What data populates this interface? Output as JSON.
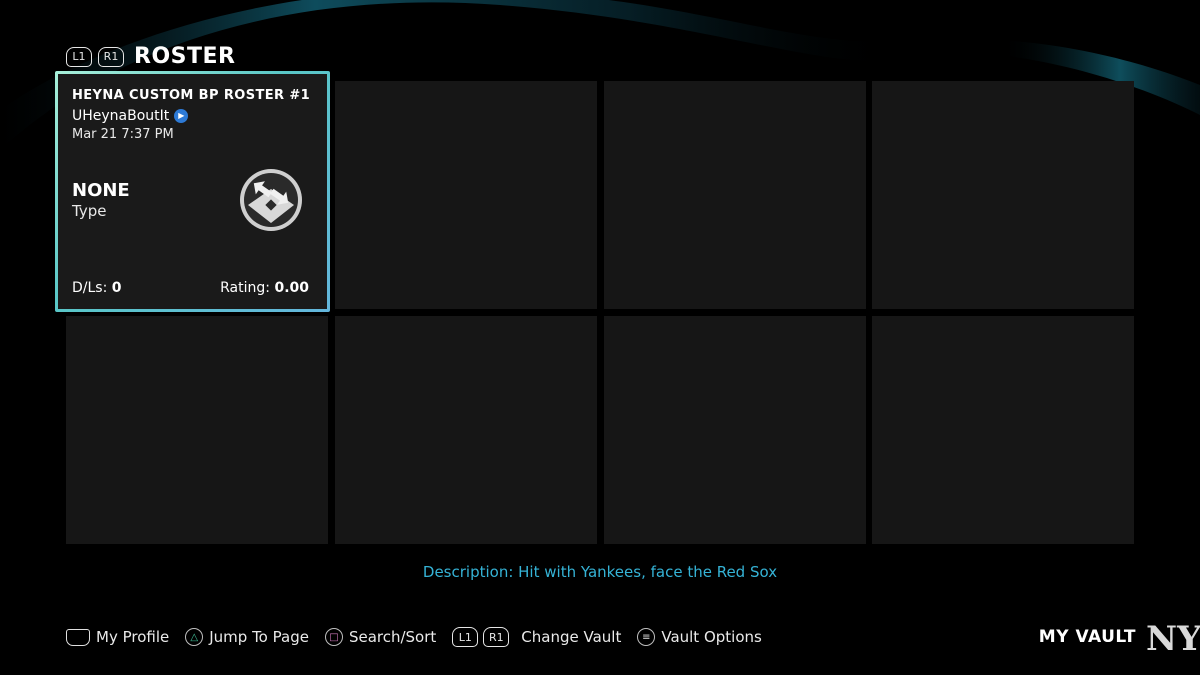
{
  "header": {
    "left_bumper": "L1",
    "right_bumper": "R1",
    "title": "ROSTER"
  },
  "selected_card": {
    "title": "HEYNA CUSTOM BP ROSTER #1",
    "username": "UHeynaBoutIt",
    "platform_badge": "ps",
    "date": "Mar 21 7:37 PM",
    "type_value": "NONE",
    "type_label": "Type",
    "icon": "roster-exchange-icon",
    "downloads_label": "D/Ls:",
    "downloads_value": "0",
    "rating_label": "Rating:",
    "rating_value": "0.00"
  },
  "empty_slots": 7,
  "description": "Description: Hit with Yankees, face the Red Sox",
  "footer": {
    "my_profile": "My Profile",
    "jump_to_page": "Jump To Page",
    "search_sort": "Search/Sort",
    "bumper_left": "L1",
    "bumper_right": "R1",
    "change_vault": "Change Vault",
    "vault_options": "Vault Options"
  },
  "vault_label": "MY VAULT",
  "team_logo_text": "NY",
  "colors": {
    "accent_description": "#35b3d6",
    "card_border_start": "#a8f0da",
    "card_border_end": "#63b6dc",
    "tile": "#161616",
    "background": "#000000"
  }
}
